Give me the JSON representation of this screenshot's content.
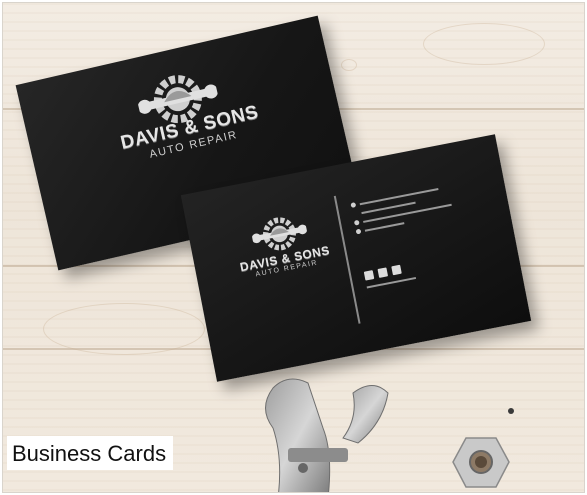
{
  "image": {
    "caption": "Business Cards",
    "card_back_brand": "DAVIS & SONS",
    "card_back_tagline": "AUTO REPAIR",
    "card_front_brand": "DAVIS & SONS",
    "card_front_tagline": "AUTO REPAIR"
  }
}
